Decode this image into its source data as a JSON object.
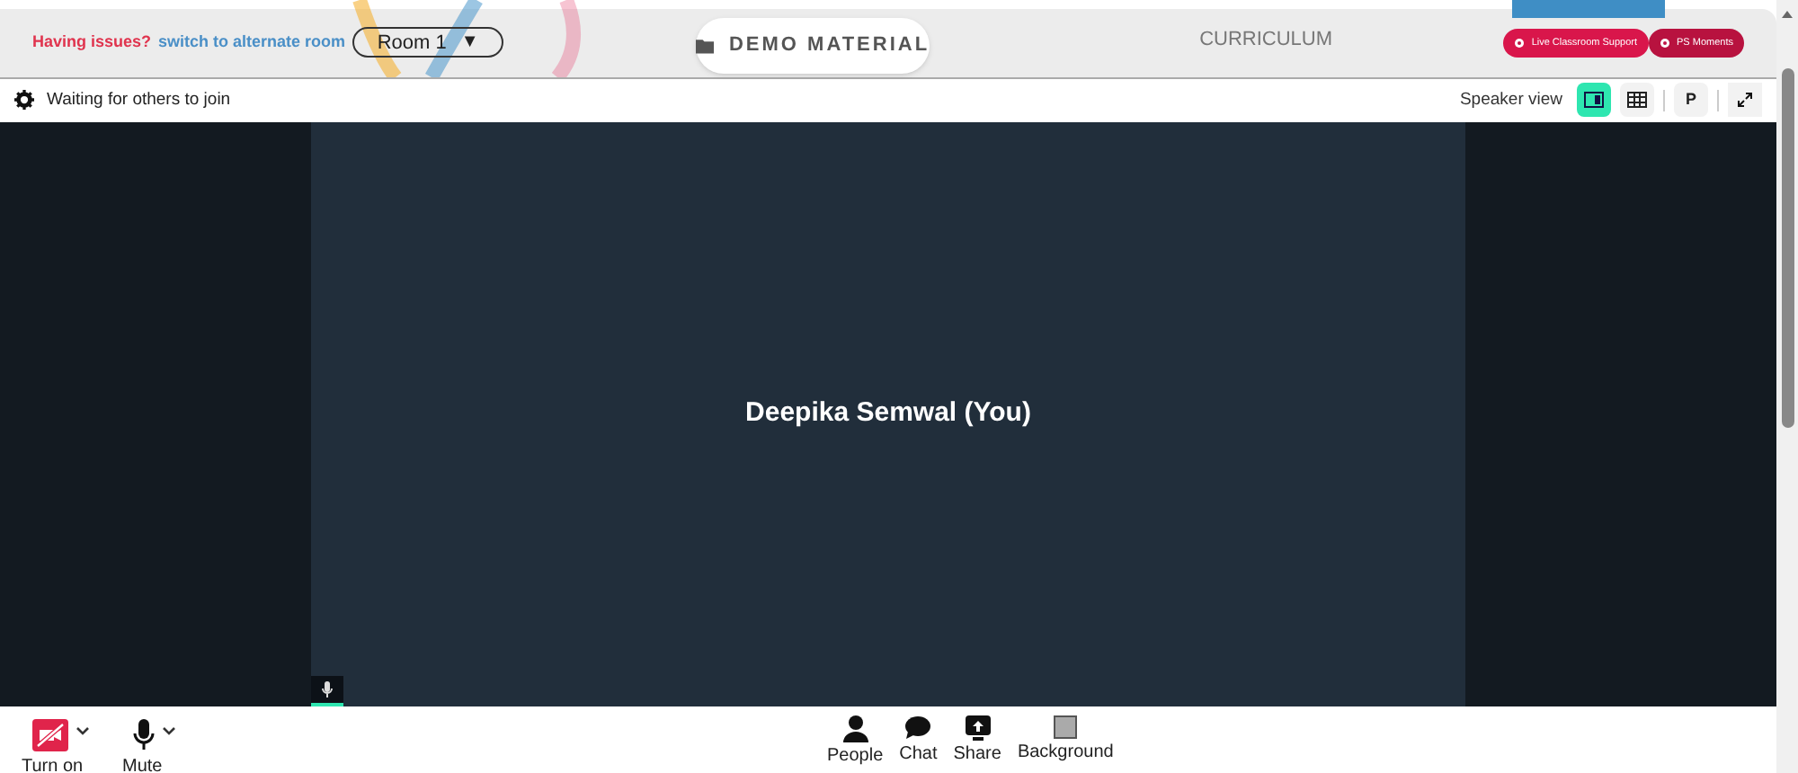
{
  "header": {
    "issues_label": "Having issues?",
    "switch_link": "switch to alternate room",
    "room_select": "Room 1",
    "caret": "▼",
    "demo_tab": "DEMO MATERIAL",
    "curriculum_tab": "CURRICULUM",
    "support_buttons": [
      "Live Classroom Support",
      "PS Moments"
    ]
  },
  "toolbar": {
    "status": "Waiting for others to join",
    "view_label": "Speaker view",
    "views": [
      {
        "kind": "speaker",
        "selected": true
      },
      {
        "kind": "grid",
        "selected": false
      },
      {
        "kind": "letter",
        "label": "P",
        "selected": false
      }
    ]
  },
  "stage": {
    "participant": "Deepika Semwal (You)"
  },
  "controls_left": [
    {
      "kind": "camera",
      "label": "Turn on"
    },
    {
      "kind": "mic",
      "label": "Mute"
    }
  ],
  "controls_center": [
    {
      "kind": "people",
      "label": "People"
    },
    {
      "kind": "chat",
      "label": "Chat"
    },
    {
      "kind": "share",
      "label": "Share"
    },
    {
      "kind": "background",
      "label": "Background"
    }
  ]
}
